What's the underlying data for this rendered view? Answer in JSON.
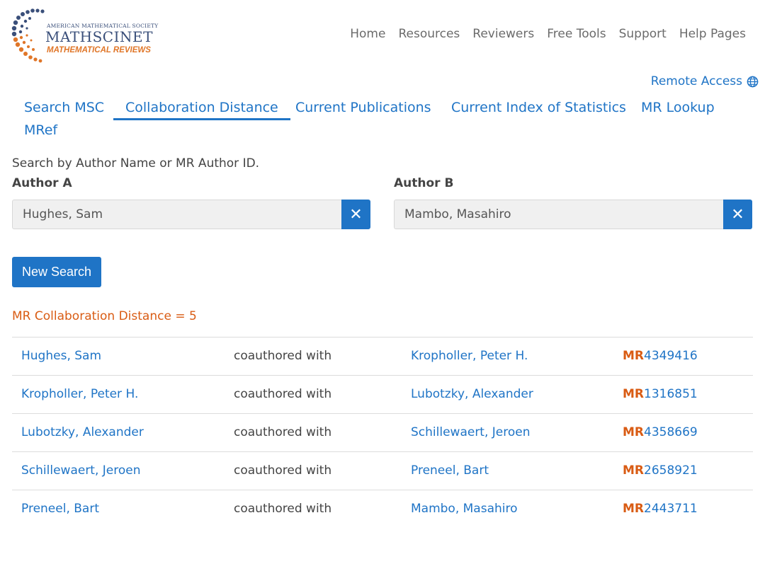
{
  "logo": {
    "line1": "AMERICAN MATHEMATICAL SOCIETY",
    "line2": "MATHSCINET",
    "line3": "MATHEMATICAL REVIEWS"
  },
  "topnav": [
    "Home",
    "Resources",
    "Reviewers",
    "Free Tools",
    "Support",
    "Help Pages"
  ],
  "remote_access": "Remote Access",
  "tabs": [
    {
      "label": "Search MSC",
      "active": false
    },
    {
      "label": "Collaboration Distance",
      "active": true
    },
    {
      "label": "Current Publications",
      "active": false
    },
    {
      "label": "Current Index of Statistics",
      "active": false
    },
    {
      "label": "MR Lookup",
      "active": false
    },
    {
      "label": "MRef",
      "active": false
    }
  ],
  "search": {
    "instruction": "Search by Author Name or MR Author ID.",
    "author_a_label": "Author A",
    "author_a_value": "Hughes, Sam",
    "author_b_label": "Author B",
    "author_b_value": "Mambo, Masahiro",
    "clear_symbol": "✕",
    "new_search_label": "New Search"
  },
  "result_text": "MR Collaboration Distance = 5",
  "mr_prefix": "MR",
  "rows": [
    {
      "a": "Hughes, Sam",
      "relation": "coauthored with",
      "b": "Kropholler, Peter H.",
      "mr": "4349416"
    },
    {
      "a": "Kropholler, Peter H.",
      "relation": "coauthored with",
      "b": "Lubotzky, Alexander",
      "mr": "1316851"
    },
    {
      "a": "Lubotzky, Alexander",
      "relation": "coauthored with",
      "b": "Schillewaert, Jeroen",
      "mr": "4358669"
    },
    {
      "a": "Schillewaert, Jeroen",
      "relation": "coauthored with",
      "b": "Preneel, Bart",
      "mr": "2658921"
    },
    {
      "a": "Preneel, Bart",
      "relation": "coauthored with",
      "b": "Mambo, Masahiro",
      "mr": "2443711"
    }
  ],
  "colors": {
    "link": "#1f74c6",
    "accent": "#d95c14",
    "logo_blue": "#3a4f7a",
    "logo_orange": "#e07628"
  }
}
